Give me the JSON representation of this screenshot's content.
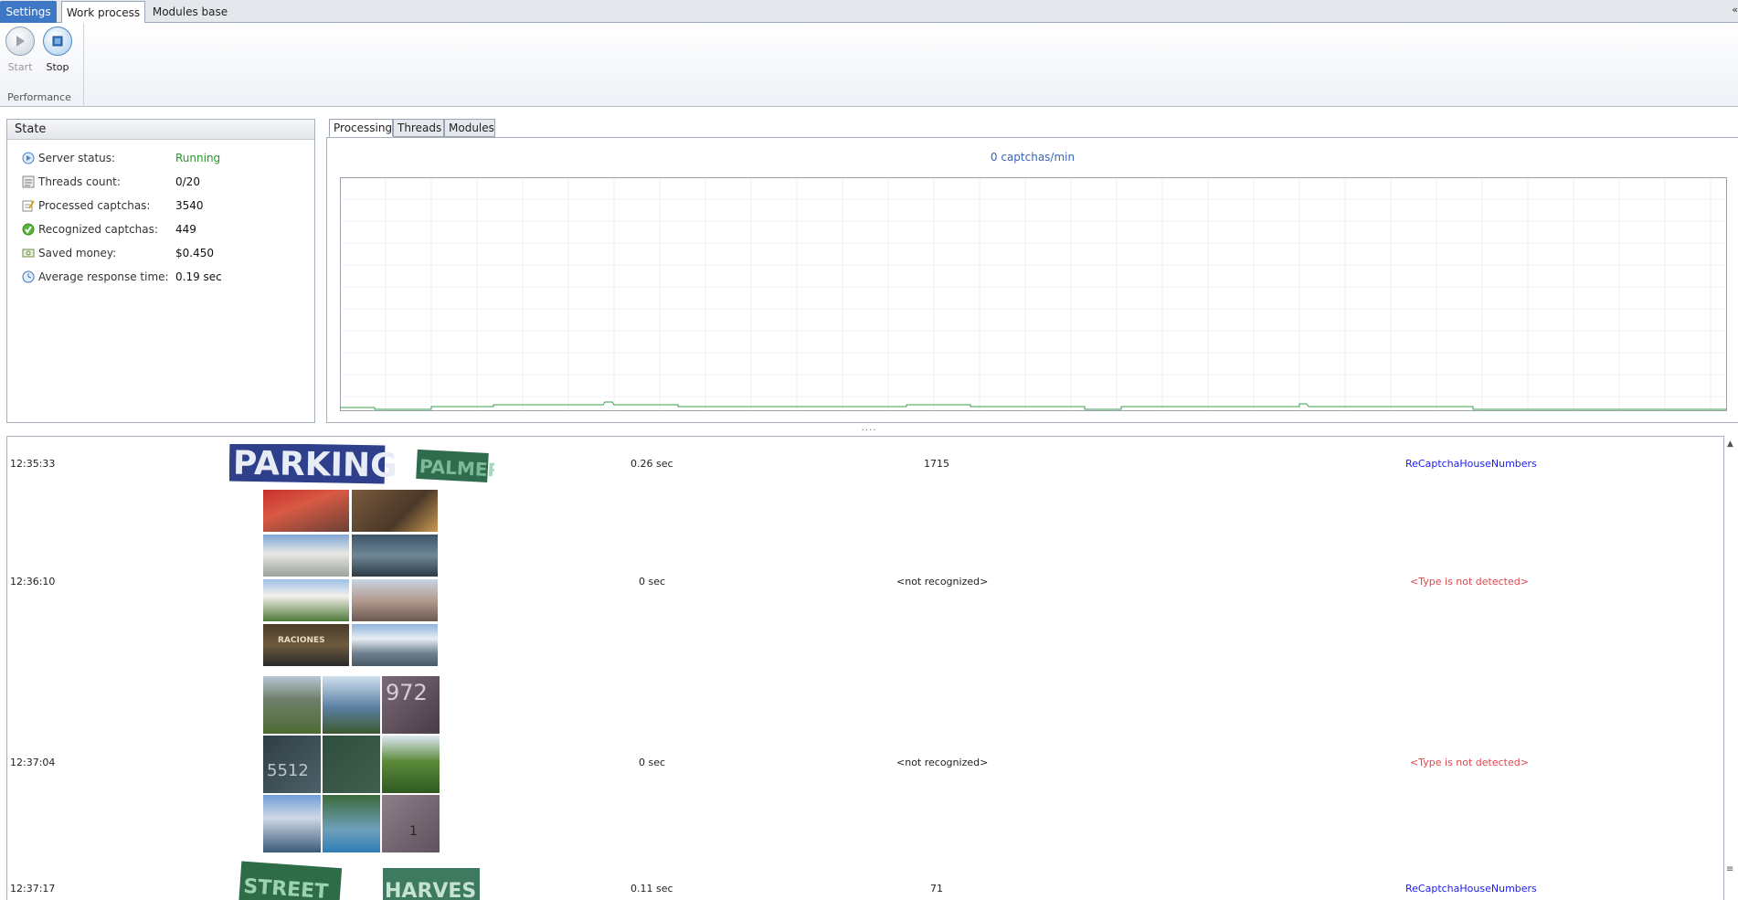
{
  "tabs": {
    "settings": "Settings",
    "work_process": "Work process",
    "modules_base": "Modules base"
  },
  "ribbon": {
    "start_label": "Start",
    "stop_label": "Stop",
    "group_label": "Performance"
  },
  "state": {
    "header": "State",
    "rows": [
      {
        "key": "Server status:",
        "value": "Running",
        "icon": "server-status-icon"
      },
      {
        "key": "Threads count:",
        "value": "0/20",
        "icon": "threads-icon"
      },
      {
        "key": "Processed captchas:",
        "value": "3540",
        "icon": "processed-icon"
      },
      {
        "key": "Recognized captchas:",
        "value": "449",
        "icon": "recognized-check-icon"
      },
      {
        "key": "Saved money:",
        "value": "$0.450",
        "icon": "money-icon"
      },
      {
        "key": "Average response time:",
        "value": "0.19 sec",
        "icon": "clock-icon"
      }
    ]
  },
  "panel_tabs": [
    "Processing",
    "Threads",
    "Modules"
  ],
  "chart": {
    "title": "0 captchas/min",
    "line_color": "#3aa14a"
  },
  "log": [
    {
      "time": "12:35:33",
      "response": "0.26 sec",
      "answer": "1715",
      "type": "ReCaptchaHouseNumbers",
      "image_text": [
        "PARKING",
        "PALMER"
      ]
    },
    {
      "time": "12:36:10",
      "response": "0 sec",
      "answer": "<not recognized>",
      "type": "<Type is not detected>"
    },
    {
      "time": "12:37:04",
      "response": "0 sec",
      "answer": "<not recognized>",
      "type": "<Type is not detected>",
      "image_text": [
        "972",
        "5512",
        "1"
      ]
    },
    {
      "time": "12:37:17",
      "response": "0.11 sec",
      "answer": "71",
      "type": "ReCaptchaHouseNumbers",
      "image_text": [
        "STREET",
        "HARVES"
      ]
    }
  ],
  "grid_tile_text": "RACIONES",
  "splitter_glyph": "....",
  "corner_glyph": "«"
}
